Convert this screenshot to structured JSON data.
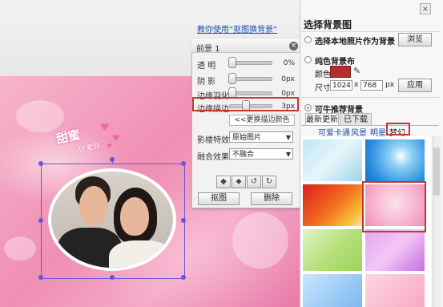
{
  "canvas": {
    "help_link": "教你使用“抠图换背景”",
    "deco_text": "甜蜜",
    "deco_sub": "好爱你"
  },
  "panel": {
    "title": "前景 1",
    "rows": [
      {
        "label": "透  明",
        "value": "0%"
      },
      {
        "label": "阴  影",
        "value": "0px"
      },
      {
        "label": "边缘羽化",
        "value": "0px"
      },
      {
        "label": "边缘描边",
        "value": "3px"
      }
    ],
    "more_link": "<<更换描边颜色",
    "effect_label": "影楼特效",
    "effect_value": "原始图片",
    "blend_label": "融合效果",
    "blend_value": "不融合",
    "cutout_button": "抠图",
    "delete_button": "删除"
  },
  "right": {
    "title": "选择背景图",
    "option_local": "选择本地照片作为背景",
    "browse_button": "浏览",
    "option_solid": "纯色背景布",
    "color_label": "颜色",
    "color_value": "#b03030",
    "size_label": "尺寸",
    "width": "1024",
    "x_sep": "x",
    "height": "768",
    "unit": "px",
    "apply_button": "应用",
    "option_recommend": "可牛推荐背景",
    "tabs": [
      "最新更新",
      "已下载"
    ],
    "categories": [
      "可爱卡通",
      "风景",
      "明星",
      "梦幻"
    ]
  }
}
